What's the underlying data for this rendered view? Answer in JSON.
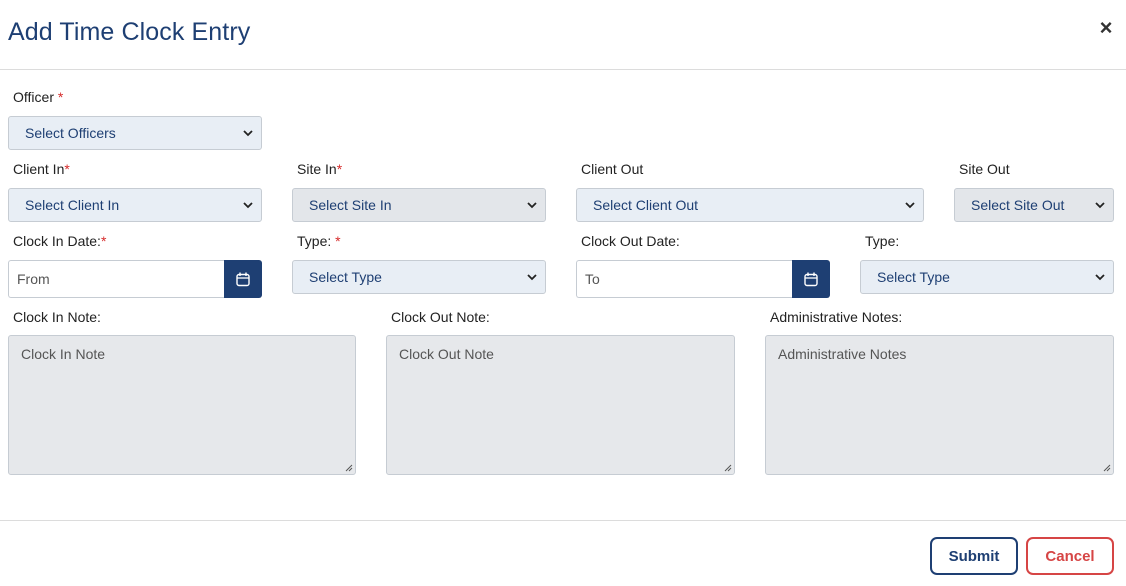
{
  "modal": {
    "title": "Add Time Clock Entry",
    "close_glyph": "×"
  },
  "fields": {
    "officer": {
      "label": "Officer",
      "required_mark": "*",
      "select": "Select Officers"
    },
    "client_in": {
      "label": "Client In",
      "required_mark": "*",
      "select": "Select Client In"
    },
    "site_in": {
      "label": "Site In",
      "required_mark": "*",
      "select": "Select Site In"
    },
    "client_out": {
      "label": "Client Out",
      "select": "Select Client Out"
    },
    "site_out": {
      "label": "Site Out",
      "select": "Select Site Out"
    },
    "clock_in_date": {
      "label": "Clock In Date:",
      "required_mark": "*",
      "placeholder": "From"
    },
    "type_in": {
      "label": "Type:",
      "required_mark": "*",
      "select": "Select Type"
    },
    "clock_out_date": {
      "label": "Clock Out Date:",
      "placeholder": "To"
    },
    "type_out": {
      "label": "Type:",
      "select": "Select Type"
    },
    "clock_in_note": {
      "label": "Clock In Note:",
      "placeholder": "Clock In Note"
    },
    "clock_out_note": {
      "label": "Clock Out Note:",
      "placeholder": "Clock Out Note"
    },
    "admin_notes": {
      "label": "Administrative Notes:",
      "placeholder": "Administrative Notes"
    }
  },
  "footer": {
    "submit_label": "Submit",
    "cancel_label": "Cancel"
  },
  "colors": {
    "primary": "#1e3f73",
    "danger": "#d64545",
    "required": "#d62b2b"
  },
  "icons": {
    "close": "close-icon",
    "calendar": "calendar-icon",
    "chevron": "chevron-down-icon"
  }
}
